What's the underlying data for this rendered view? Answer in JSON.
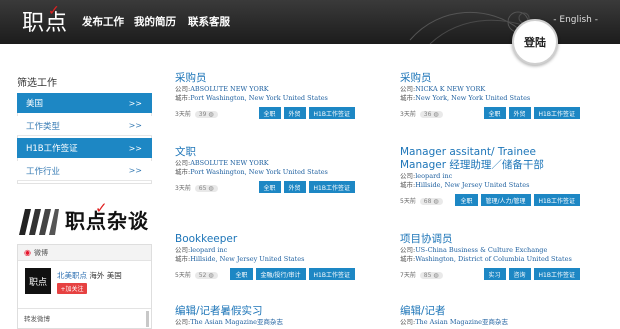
{
  "header": {
    "logo": "职点",
    "nav": [
      "发布工作",
      "我的简历",
      "联系客服"
    ],
    "language": "- English -",
    "login": "登陆"
  },
  "sidebar": {
    "title": "筛选工作",
    "filters": [
      {
        "label": "美国",
        "arrow": ">>",
        "active": true
      },
      {
        "label": "工作类型",
        "arrow": ">>",
        "active": false
      },
      {
        "label": "H1B工作签证",
        "arrow": ">>",
        "active": true
      },
      {
        "label": "工作行业",
        "arrow": ">>",
        "active": false
      }
    ],
    "magazine": "职点杂谈",
    "weibo": {
      "header": "微博",
      "avatar": "职点",
      "name": "北美职点",
      "location": "海外 美国",
      "follow": "+加关注",
      "repost": "转发微博"
    }
  },
  "jobs": [
    {
      "title": "采购员",
      "company_label": "公司:",
      "company": "ABSOLUTE NEW YORK",
      "city_label": "城市:",
      "city": "Port Washington, New York United States",
      "age": "3天前",
      "views": "39",
      "tags": [
        "全职",
        "外贸",
        "H1B工作签证"
      ]
    },
    {
      "title": "采购员",
      "company_label": "公司:",
      "company": "NICKA K NEW YORK",
      "city_label": "城市:",
      "city": "New York, New York United States",
      "age": "3天前",
      "views": "36",
      "tags": [
        "全职",
        "外贸",
        "H1B工作签证"
      ]
    },
    {
      "title": "文职",
      "company_label": "公司:",
      "company": "ABSOLUTE NEW YORK",
      "city_label": "城市:",
      "city": "Port Washington, New York United States",
      "age": "3天前",
      "views": "65",
      "tags": [
        "全职",
        "外贸",
        "H1B工作签证"
      ]
    },
    {
      "title": "Manager assitant/ Trainee Manager 经理助理／储备干部",
      "company_label": "公司:",
      "company": "leopard inc",
      "city_label": "城市:",
      "city": "Hillside, New Jersey United States",
      "age": "5天前",
      "views": "68",
      "tags": [
        "全职",
        "管理/人力/管理",
        "H1B工作签证"
      ]
    },
    {
      "title": "Bookkeeper",
      "company_label": "公司:",
      "company": "leopard inc",
      "city_label": "城市:",
      "city": "Hillside, New Jersey United States",
      "age": "5天前",
      "views": "52",
      "tags": [
        "全职",
        "金融/投行/审计",
        "H1B工作签证"
      ]
    },
    {
      "title": "项目协调员",
      "company_label": "公司:",
      "company": "US-China Business & Culture Exchange",
      "city_label": "城市:",
      "city": "Washington, District of Columbia United States",
      "age": "7天前",
      "views": "85",
      "tags": [
        "实习",
        "咨询",
        "H1B工作签证"
      ]
    },
    {
      "title": "编辑/记者暑假实习",
      "company_label": "公司:",
      "company": "The Asian Magazine亚商杂志",
      "city_label": "",
      "city": "",
      "age": "",
      "views": "",
      "tags": []
    },
    {
      "title": "编辑/记者",
      "company_label": "公司:",
      "company": "The Asian Magazine亚商杂志",
      "city_label": "",
      "city": "",
      "age": "",
      "views": "",
      "tags": []
    }
  ],
  "colors": {
    "accent": "#1d87c4",
    "link": "#1d75b8",
    "header_bg": "#262626",
    "follow": "#e64141"
  }
}
